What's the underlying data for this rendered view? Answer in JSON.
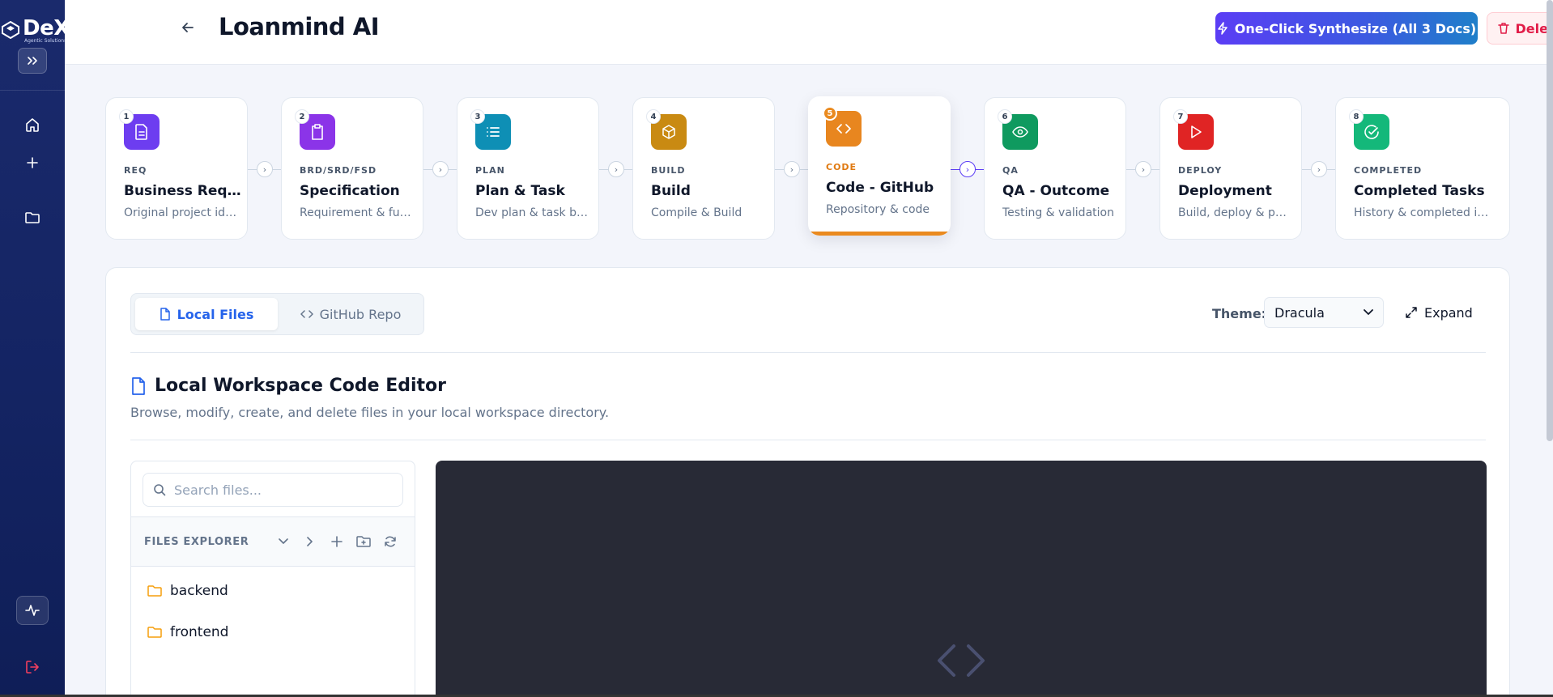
{
  "sidebar": {
    "logo_text": "DeX",
    "logo_sub": "Agentic Solutions",
    "nav_icons": [
      "home-icon",
      "plus-icon",
      "folder-icon"
    ],
    "bottom_icons": [
      "activity-icon",
      "logout-icon"
    ]
  },
  "header": {
    "title": "Loanmind AI",
    "synth_label": "One-Click Synthesize (All 3 Docs)",
    "delete_label": "Delete"
  },
  "steps": [
    {
      "num": "1",
      "tag": "REQ",
      "name": "Business Requirements",
      "desc": "Original project idea",
      "color": "#6d3df0",
      "icon": "document-icon"
    },
    {
      "num": "2",
      "tag": "BRD/SRD/FSD",
      "name": "Specification",
      "desc": "Requirement & functional",
      "color": "#8b34e8",
      "icon": "clipboard-icon"
    },
    {
      "num": "3",
      "tag": "PLAN",
      "name": "Plan & Task",
      "desc": "Dev plan & task breakdown",
      "color": "#0e8fb5",
      "icon": "list-icon"
    },
    {
      "num": "4",
      "tag": "BUILD",
      "name": "Build",
      "desc": "Compile & Build",
      "color": "#c98a12",
      "icon": "package-icon"
    },
    {
      "num": "5",
      "tag": "CODE",
      "name": "Code - GitHub",
      "desc": "Repository & code",
      "color": "#e8861f",
      "icon": "code-icon",
      "active": true
    },
    {
      "num": "6",
      "tag": "QA",
      "name": "QA - Outcome",
      "desc": "Testing & validation",
      "color": "#0f9a5f",
      "icon": "eye-icon"
    },
    {
      "num": "7",
      "tag": "DEPLOY",
      "name": "Deployment",
      "desc": "Build, deploy & publish",
      "color": "#e02424",
      "icon": "play-icon"
    },
    {
      "num": "8",
      "tag": "COMPLETED",
      "name": "Completed Tasks",
      "desc": "History & completed items",
      "color": "#14b87a",
      "icon": "check-circle-icon"
    }
  ],
  "tabs": {
    "local": "Local Files",
    "github": "GitHub Repo"
  },
  "theme": {
    "label": "Theme:",
    "value": "Dracula"
  },
  "expand_label": "Expand",
  "section": {
    "title": "Local Workspace Code Editor",
    "desc": "Browse, modify, create, and delete files in your local workspace directory."
  },
  "explorer": {
    "search_placeholder": "Search files...",
    "label": "FILES EXPLORER",
    "folders": [
      "backend",
      "frontend"
    ]
  }
}
